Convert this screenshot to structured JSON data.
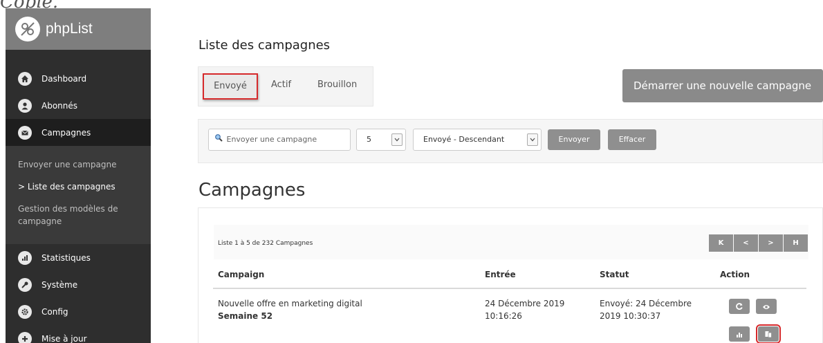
{
  "corner_text": "Copie.",
  "app": {
    "name": "phpList"
  },
  "sidebar": {
    "items": [
      {
        "label": "Dashboard",
        "icon": "home-icon"
      },
      {
        "label": "Abonnés",
        "icon": "user-icon"
      },
      {
        "label": "Campagnes",
        "icon": "envelope-icon"
      },
      {
        "label": "Statistiques",
        "icon": "bar-chart-icon"
      },
      {
        "label": "Système",
        "icon": "wrench-icon"
      },
      {
        "label": "Config",
        "icon": "gear-icon"
      },
      {
        "label": "Mise à jour",
        "icon": "plus-icon"
      }
    ],
    "subitems": [
      {
        "label": "Envoyer une campagne"
      },
      {
        "label": "Liste des campagnes"
      },
      {
        "label": "Gestion des modèles de campagne"
      }
    ],
    "current_marker": ">"
  },
  "page": {
    "title": "Liste des campagnes"
  },
  "tabs": [
    {
      "label": "Envoyé"
    },
    {
      "label": "Actif"
    },
    {
      "label": "Brouillon"
    }
  ],
  "new_campaign_button": "Démarrer une nouvelle campagne",
  "filter": {
    "search_placeholder": "Envoyer une campagne",
    "per_page": "5",
    "sort": "Envoyé - Descendant",
    "submit_label": "Envoyer",
    "clear_label": "Effacer"
  },
  "section_title": "Campagnes",
  "list_info": "Liste 1 à 5 de 232 Campagnes",
  "pager": {
    "first": "K",
    "prev": "<",
    "next": ">",
    "last": "H"
  },
  "table": {
    "headers": [
      "Campaign",
      "Entrée",
      "Statut",
      "Action"
    ],
    "rows": [
      {
        "campaign": "Nouvelle offre en marketing digital",
        "subtitle": "Semaine 52",
        "entry_date": "24 Décembre 2019",
        "entry_time": "10:16:26",
        "status_line1": "Envoyé: 24 Décembre",
        "status_line2": "2019 10:30:37"
      }
    ]
  },
  "colors": {
    "highlight": "#d6292b",
    "sidebar_bg": "#2e2e2e",
    "button_grey": "#8f8f8f"
  }
}
